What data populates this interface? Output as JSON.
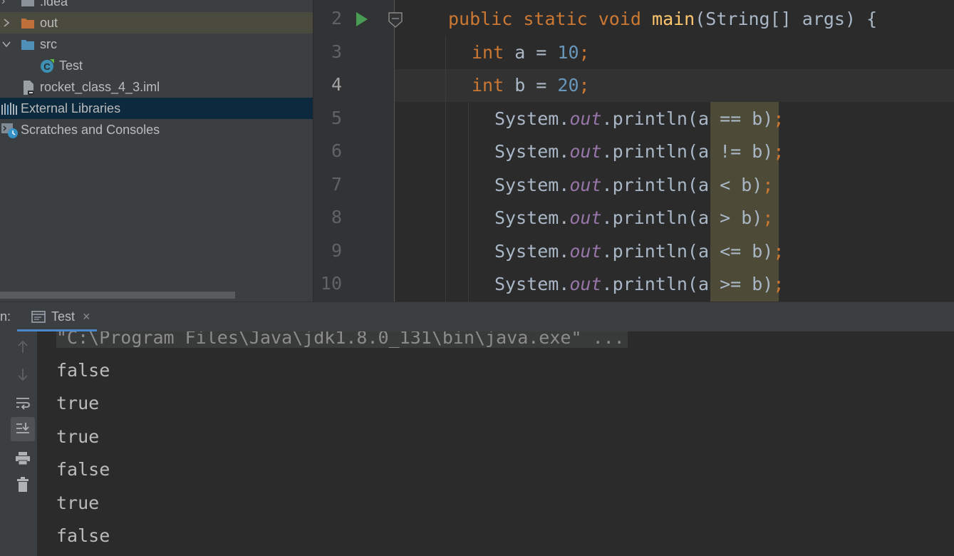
{
  "project_tree": {
    "items": [
      {
        "label": ".idea",
        "type": "folder"
      },
      {
        "label": "out",
        "type": "folder-excluded"
      },
      {
        "label": "src",
        "type": "source-folder"
      },
      {
        "label": "Test",
        "type": "java-class"
      },
      {
        "label": "rocket_class_4_3.iml",
        "type": "module-file"
      },
      {
        "label": "External Libraries",
        "type": "libraries"
      },
      {
        "label": "Scratches and Consoles",
        "type": "scratches"
      }
    ]
  },
  "editor": {
    "line_numbers": [
      "2",
      "3",
      "4",
      "5",
      "6",
      "7",
      "8",
      "9",
      "10"
    ],
    "lines": {
      "l2": {
        "kw1": "public",
        "kw2": "static",
        "kw3": "void",
        "fn": "main",
        "rest": "(String[] args) {"
      },
      "l3": {
        "kw": "int",
        "mid": " a = ",
        "num": "10",
        "end": ";"
      },
      "l4": {
        "kw": "int",
        "mid": " b = ",
        "num": "20",
        "end": ";"
      },
      "l5": {
        "pre": "System.",
        "fld": "out",
        "call": ".println(",
        "arg": "a == b",
        "close": ")",
        "end": ";"
      },
      "l6": {
        "pre": "System.",
        "fld": "out",
        "call": ".println(",
        "arg": "a != b",
        "close": ")",
        "end": ";"
      },
      "l7": {
        "pre": "System.",
        "fld": "out",
        "call": ".println(",
        "arg": "a < b",
        "close": ")",
        "end": ";"
      },
      "l8": {
        "pre": "System.",
        "fld": "out",
        "call": ".println(",
        "arg": "a > b",
        "close": ")",
        "end": ";"
      },
      "l9": {
        "pre": "System.",
        "fld": "out",
        "call": ".println(",
        "arg": "a <= b",
        "close": ")",
        "end": ";"
      },
      "l10": {
        "pre": "System.",
        "fld": "out",
        "call": ".println(",
        "arg": "a >= b",
        "close": ")",
        "end": ";"
      }
    }
  },
  "run_panel": {
    "label": "n:",
    "tab_label": "Test",
    "tab_close": "×",
    "command": "\"C:\\Program Files\\Java\\jdk1.8.0_131\\bin\\java.exe\" ...",
    "output": [
      "false",
      "true",
      "true",
      "false",
      "true",
      "false"
    ]
  },
  "colors": {
    "keyword": "#cc7832",
    "function": "#ffc66d",
    "number": "#6897bb",
    "field": "#9876aa",
    "text": "#a9b7c6",
    "selection": "#0d293e"
  }
}
